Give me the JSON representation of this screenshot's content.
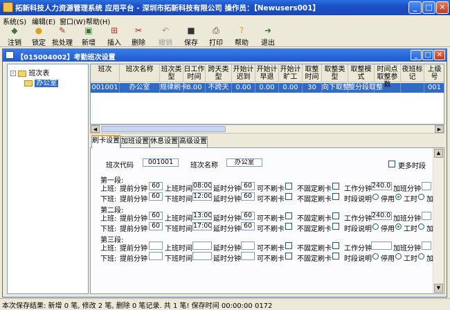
{
  "window": {
    "title": "拓新科技人力资源管理系统 应用平台 - 深圳市拓新科技有限公司    操作员：【Newusers001】"
  },
  "menu": [
    "系统(S)",
    "编辑(E)",
    "窗口(W)",
    "帮助(H)"
  ],
  "toolbar": [
    {
      "label": "注销",
      "icon": "logout-icon",
      "glyph": "◆",
      "color": "#3a7a3a",
      "enabled": true
    },
    {
      "label": "锁定",
      "icon": "lock-icon",
      "glyph": "●",
      "color": "#d9a21b",
      "enabled": true
    },
    {
      "label": "批处理",
      "icon": "batch-icon",
      "glyph": "✎",
      "color": "#b03030",
      "enabled": true
    },
    {
      "label": "新增",
      "icon": "new-icon",
      "glyph": "▣",
      "color": "#2d7a2d",
      "enabled": true
    },
    {
      "label": "插入",
      "icon": "insert-icon",
      "glyph": "⊞",
      "color": "#c03030",
      "enabled": true
    },
    {
      "label": "删除",
      "icon": "delete-icon",
      "glyph": "✂",
      "color": "#b02020",
      "enabled": true
    },
    {
      "label": "撤销",
      "icon": "undo-icon",
      "glyph": "↶",
      "color": "#9a9a9a",
      "enabled": false
    },
    {
      "label": "保存",
      "icon": "save-icon",
      "glyph": "■",
      "color": "#333333",
      "enabled": true
    },
    {
      "label": "打印",
      "icon": "print-icon",
      "glyph": "⎙",
      "color": "#333333",
      "enabled": true
    },
    {
      "label": "帮助",
      "icon": "help-icon",
      "glyph": "?",
      "color": "#d9a21b",
      "enabled": true
    },
    {
      "label": "退出",
      "icon": "exit-icon",
      "glyph": "➜",
      "color": "#2d7a2d",
      "enabled": true
    }
  ],
  "child": {
    "title": "【015004002】考勤班次设置"
  },
  "tree": {
    "root": "班次表",
    "child": "办公室"
  },
  "grid": {
    "headers": [
      "班次",
      "班次名称",
      "班次类型",
      "日工作时间",
      "跨天类型",
      "开始计迟到",
      "开始计早退",
      "开始计旷工",
      "取整时间",
      "取整类型",
      "取整模式",
      "时间点取整参数",
      "夜班标记",
      "上级号"
    ],
    "row": [
      "001001",
      "办公室",
      "规律刷卡",
      "8.00",
      "不跨天",
      "0.00",
      "0.00",
      "0.00",
      "30",
      "向下取整",
      "整分段取整",
      "",
      "",
      "001"
    ]
  },
  "tabs": [
    "刷卡设置",
    "加班设置",
    "休息设置",
    "高级设置"
  ],
  "form": {
    "code_label": "班次代码",
    "code_value": "001001",
    "name_label": "班次名称",
    "name_value": "办公室",
    "more_label": "更多时段",
    "periods": [
      {
        "title": "第一段:",
        "on_before": "60",
        "on_time": "08:00",
        "on_delay": "60",
        "off_before": "60",
        "off_time": "12:00",
        "off_delay": "60",
        "work_minutes": "240.00",
        "radio": "工时"
      },
      {
        "title": "第二段:",
        "on_before": "60",
        "on_time": "13:00",
        "on_delay": "60",
        "off_before": "60",
        "off_time": "17:00",
        "off_delay": "60",
        "work_minutes": "240.00",
        "radio": "工时"
      },
      {
        "title": "第三段:",
        "on_before": "",
        "on_time": "",
        "on_delay": "",
        "off_before": "",
        "off_time": "",
        "off_delay": "",
        "work_minutes": "",
        "radio": ""
      }
    ],
    "labels": {
      "on": "上班:",
      "off": "下班:",
      "before": "提前分钟",
      "on_time": "上班时间",
      "off_time": "下班时间",
      "delay": "延时分钟",
      "no_punch": "可不刷卡",
      "not_fixed": "不固定刷卡",
      "work_min": "工作分钟",
      "ot_min": "加班分钟",
      "period_desc": "时段说明",
      "disable": "停用",
      "work_hours": "工时",
      "overtime_short": "加"
    }
  },
  "status": {
    "text": "本次保存结果: 新增 0 笔, 修改 2 笔, 删除 0 笔记录. 共 1 笔! 保存时间 00:00:00 0172"
  }
}
